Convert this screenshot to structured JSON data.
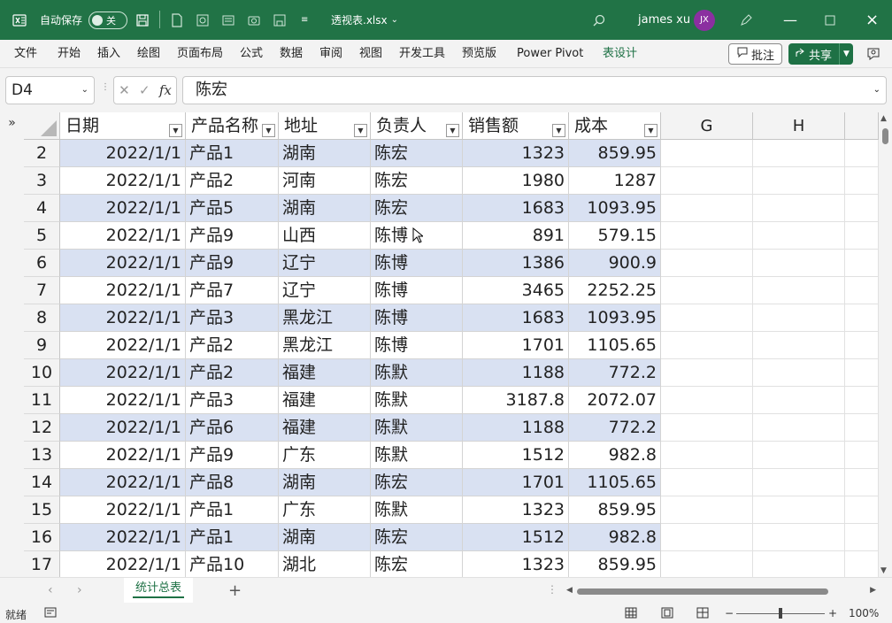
{
  "titlebar": {
    "autosave_label": "自动保存",
    "autosave_state": "关",
    "filename": "透视表.xlsx",
    "user_name": "james xu",
    "user_initials": "JX"
  },
  "menu": {
    "items": [
      "文件",
      "开始",
      "插入",
      "绘图",
      "页面布局",
      "公式",
      "数据",
      "审阅",
      "视图",
      "开发工具",
      "预览版",
      "Power Pivot",
      "表设计"
    ],
    "comment_label": "批注",
    "share_label": "共享"
  },
  "formula_bar": {
    "name_box": "D4",
    "fx_label": "fx",
    "formula": "陈宏"
  },
  "sheet": {
    "headers": [
      "日期",
      "产品名称",
      "地址",
      "负责人",
      "销售额",
      "成本"
    ],
    "extra_columns": [
      "G",
      "H"
    ],
    "rows": [
      {
        "row": "2",
        "cells": [
          "2022/1/1",
          "产品1",
          "湖南",
          "陈宏",
          "1323",
          "859.95"
        ]
      },
      {
        "row": "3",
        "cells": [
          "2022/1/1",
          "产品2",
          "河南",
          "陈宏",
          "1980",
          "1287"
        ]
      },
      {
        "row": "4",
        "cells": [
          "2022/1/1",
          "产品5",
          "湖南",
          "陈宏",
          "1683",
          "1093.95"
        ]
      },
      {
        "row": "5",
        "cells": [
          "2022/1/1",
          "产品9",
          "山西",
          "陈博",
          "891",
          "579.15"
        ]
      },
      {
        "row": "6",
        "cells": [
          "2022/1/1",
          "产品9",
          "辽宁",
          "陈博",
          "1386",
          "900.9"
        ]
      },
      {
        "row": "7",
        "cells": [
          "2022/1/1",
          "产品7",
          "辽宁",
          "陈博",
          "3465",
          "2252.25"
        ]
      },
      {
        "row": "8",
        "cells": [
          "2022/1/1",
          "产品3",
          "黑龙江",
          "陈博",
          "1683",
          "1093.95"
        ]
      },
      {
        "row": "9",
        "cells": [
          "2022/1/1",
          "产品2",
          "黑龙江",
          "陈博",
          "1701",
          "1105.65"
        ]
      },
      {
        "row": "10",
        "cells": [
          "2022/1/1",
          "产品2",
          "福建",
          "陈默",
          "1188",
          "772.2"
        ]
      },
      {
        "row": "11",
        "cells": [
          "2022/1/1",
          "产品3",
          "福建",
          "陈默",
          "3187.8",
          "2072.07"
        ]
      },
      {
        "row": "12",
        "cells": [
          "2022/1/1",
          "产品6",
          "福建",
          "陈默",
          "1188",
          "772.2"
        ]
      },
      {
        "row": "13",
        "cells": [
          "2022/1/1",
          "产品9",
          "广东",
          "陈默",
          "1512",
          "982.8"
        ]
      },
      {
        "row": "14",
        "cells": [
          "2022/1/1",
          "产品8",
          "湖南",
          "陈宏",
          "1701",
          "1105.65"
        ]
      },
      {
        "row": "15",
        "cells": [
          "2022/1/1",
          "产品1",
          "广东",
          "陈默",
          "1323",
          "859.95"
        ]
      },
      {
        "row": "16",
        "cells": [
          "2022/1/1",
          "产品1",
          "湖南",
          "陈宏",
          "1512",
          "982.8"
        ]
      },
      {
        "row": "17",
        "cells": [
          "2022/1/1",
          "产品10",
          "湖北",
          "陈宏",
          "1323",
          "859.95"
        ]
      }
    ],
    "tab_name": "统计总表"
  },
  "status": {
    "ready": "就绪",
    "zoom": "100%"
  },
  "colors": {
    "accent": "#217346",
    "band": "#d9e1f2"
  }
}
